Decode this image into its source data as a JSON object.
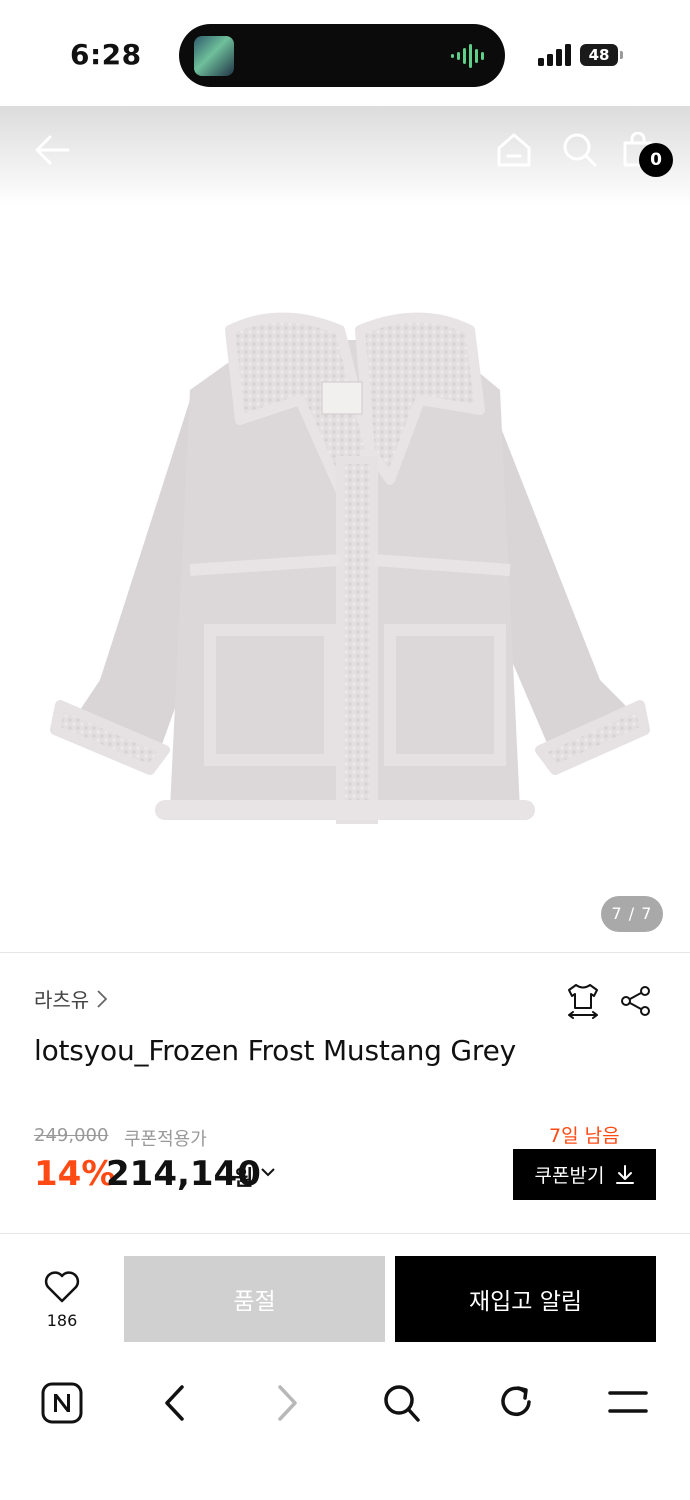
{
  "status_bar": {
    "time": "6:28",
    "battery": "48",
    "icons": [
      "album-thumbnail-icon",
      "audio-wave-icon",
      "signal-icon",
      "battery-icon"
    ]
  },
  "header": {
    "icons": [
      "back-arrow-icon",
      "home-icon",
      "search-icon",
      "cart-icon"
    ],
    "cart_count": "0"
  },
  "gallery": {
    "page_indicator": "7 / 7"
  },
  "product": {
    "brand": "라츠유",
    "title": "lotsyou_Frozen Frost Mustang Grey",
    "original_price": "249,000",
    "coupon_note": "쿠폰적용가",
    "discount": "14%",
    "price": "214,140",
    "currency": "원",
    "days_left": "7일 남음",
    "coupon_button": "쿠폰받기"
  },
  "actions": {
    "like_count": "186",
    "soldout_label": "품절",
    "restock_label": "재입고 알림"
  },
  "browser_toolbar": {
    "icons": [
      "naver-logo-icon",
      "back-icon",
      "forward-icon",
      "search-icon",
      "refresh-icon",
      "menu-icon"
    ]
  },
  "colors": {
    "accent": "#ff4a14",
    "primary_button": "#000000",
    "disabled_button": "#d0d0d0"
  }
}
